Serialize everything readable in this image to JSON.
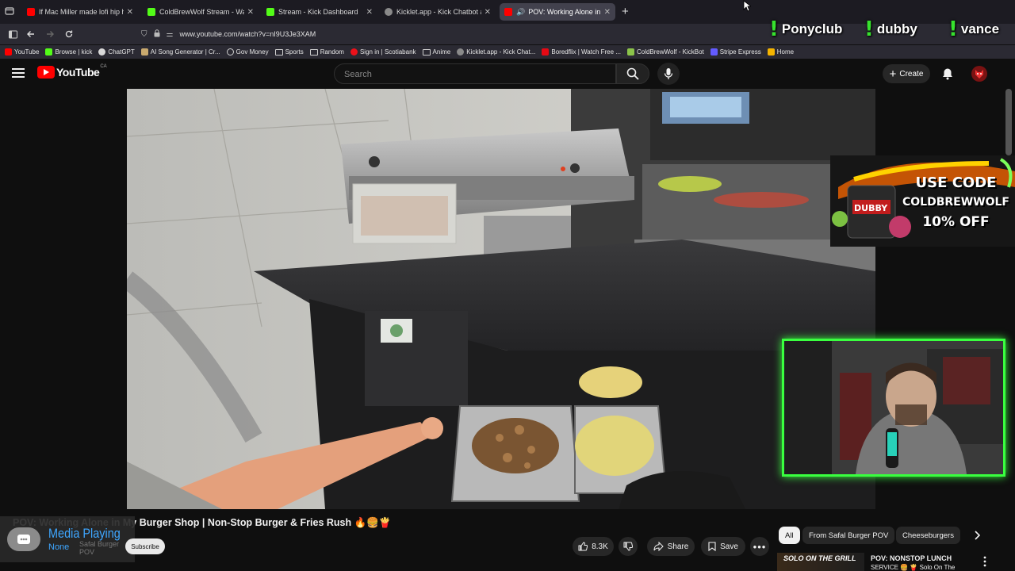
{
  "browser": {
    "tabs": [
      {
        "title": "If Mac Miller made lofi hip hop",
        "icon_color": "#ff0000",
        "active": false
      },
      {
        "title": "ColdBrewWolf Stream - Watch Liv",
        "icon_color": "#53fc18",
        "active": false
      },
      {
        "title": "Stream - Kick Dashboard",
        "icon_color": "#53fc18",
        "active": false
      },
      {
        "title": "Kicklet.app - Kick Chatbot and C",
        "icon_color": "#8a8a8a",
        "active": false
      },
      {
        "title": "POV: Working Alone in My",
        "icon_color": "#ff0000",
        "active": true
      }
    ],
    "new_tab_label": "+",
    "url": "www.youtube.com/watch?v=nI9U3Je3XAM",
    "bookmarks": [
      {
        "label": "YouTube",
        "icon_color": "#ff0000"
      },
      {
        "label": "Browse | kick",
        "icon_color": "#53fc18"
      },
      {
        "label": "ChatGPT",
        "icon_color": "#d9d9d9"
      },
      {
        "label": "AI Song Generator | Cr...",
        "icon_color": "#c9a96e"
      },
      {
        "label": "Gov Money",
        "icon_color": "#cfcfcf"
      },
      {
        "label": "Sports",
        "icon_color": "#cfcfcf"
      },
      {
        "label": "Random",
        "icon_color": "#cfcfcf"
      },
      {
        "label": "Sign in | Scotiabank",
        "icon_color": "#ec111a"
      },
      {
        "label": "Anime",
        "icon_color": "#cfcfcf"
      },
      {
        "label": "Kicklet.app - Kick Chat...",
        "icon_color": "#8a8a8a"
      },
      {
        "label": "Boredflix | Watch Free ...",
        "icon_color": "#e50914"
      },
      {
        "label": "ColdBrewWolf - KickBot",
        "icon_color": "#8bc34a"
      },
      {
        "label": "Stripe Express",
        "icon_color": "#635bff"
      },
      {
        "label": "Home",
        "icon_color": "#f5b400"
      }
    ]
  },
  "stream_overlay": {
    "commands": [
      "Ponyclub",
      "dubby",
      "vance"
    ],
    "command_prefix": "!",
    "sponsor": {
      "line1": "USE CODE",
      "line2": "COLDBREWWOLF",
      "line3": "10% OFF",
      "brand": "DUBBY"
    }
  },
  "youtube": {
    "logo_text": "YouTube",
    "region": "CA",
    "search_placeholder": "Search",
    "create_label": "Create",
    "video_title": "POV: Working Alone in My Burger Shop | Non-Stop Burger & Fries Rush 🔥🍔🍟",
    "channel_name": "Safal Burger POV",
    "subscribe_label": "Subscribe",
    "like_count": "8.3K",
    "share_label": "Share",
    "save_label": "Save",
    "chips": [
      "All",
      "From Safal Burger POV",
      "Cheeseburgers"
    ],
    "recommended": {
      "thumb_text": "SOLO ON THE GRILL",
      "title": "POV: NONSTOP LUNCH",
      "subtitle": "SERVICE 🍔 🍟 Solo On The"
    }
  },
  "media_toast": {
    "title": "Media Playing",
    "subtitle": "None"
  },
  "colors": {
    "youtube_red": "#ff0000",
    "kick_green": "#53fc18",
    "webcam_border": "#39ff3f",
    "link_blue": "#3ea6ff"
  }
}
